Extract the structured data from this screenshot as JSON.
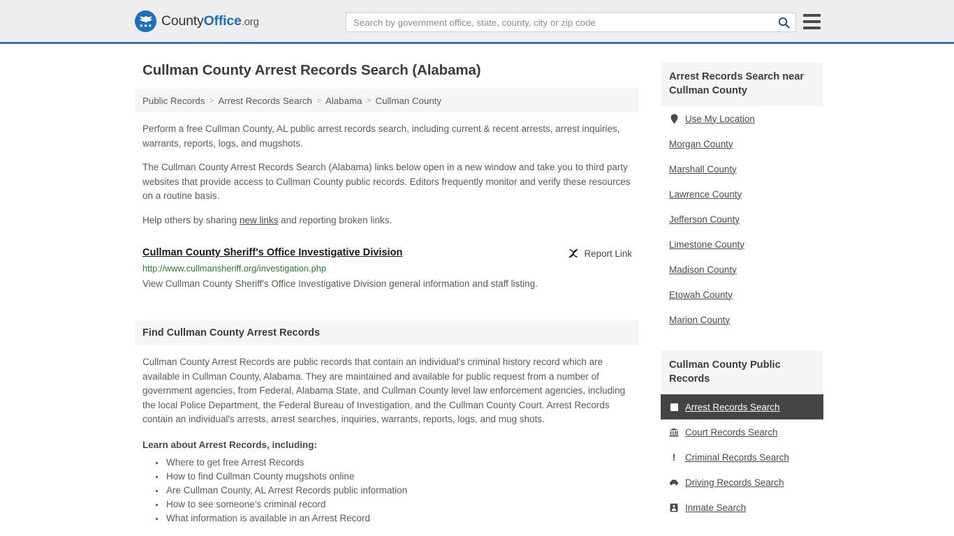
{
  "header": {
    "brand": {
      "part1": "County",
      "part2": "Office",
      "part3": ".org"
    },
    "search": {
      "placeholder": "Search by government office, state, county, city or zip code",
      "value": "",
      "icon": "search-icon"
    },
    "menu_icon": "hamburger-menu-icon"
  },
  "page": {
    "title": "Cullman County Arrest Records Search (Alabama)",
    "breadcrumb": [
      "Public Records",
      "Arrest Records Search",
      "Alabama",
      "Cullman County"
    ],
    "breadcrumb_separator": ">",
    "paragraph1": "Perform a free Cullman County, AL public arrest records search, including current & recent arrests, arrest inquiries, warrants, reports, logs, and mugshots.",
    "paragraph2": "The Cullman County Arrest Records Search (Alabama) links below open in a new window and take you to third party websites that provide access to Cullman County public records. Editors frequently monitor and verify these resources on a routine basis.",
    "paragraph3_before": "Help others by sharing ",
    "paragraph3_link": "new links",
    "paragraph3_after": " and reporting broken links."
  },
  "result": {
    "title": "Cullman County Sheriff's Office Investigative Division",
    "url": "http://www.cullmansheriff.org/investigation.php",
    "description": "View Cullman County Sheriff's Office Investigative Division general information and staff listing.",
    "report_label": "Report Link",
    "report_icon": "broken-link-icon"
  },
  "find_section": {
    "heading": "Find Cullman County Arrest Records",
    "body": "Cullman County Arrest Records are public records that contain an individual's criminal history record which are available in Cullman County, Alabama. They are maintained and available for public request from a number of government agencies, from Federal, Alabama State, and Cullman County level law enforcement agencies, including the local Police Department, the Federal Bureau of Investigation, and the Cullman County Court. Arrest Records contain an individual's arrests, arrest searches, inquiries, warrants, reports, logs, and mug shots.",
    "learn_heading": "Learn about Arrest Records, including:",
    "bullets": [
      "Where to get free Arrest Records",
      "How to find Cullman County mugshots online",
      "Are Cullman County, AL Arrest Records public information",
      "How to see someone's criminal record",
      "What information is available in an Arrest Record"
    ]
  },
  "sidebar": {
    "nearby": {
      "heading": "Arrest Records Search near Cullman County",
      "items": [
        {
          "label": "Use My Location",
          "icon": "map-pin-icon"
        },
        {
          "label": "Morgan County",
          "icon": ""
        },
        {
          "label": "Marshall County",
          "icon": ""
        },
        {
          "label": "Lawrence County",
          "icon": ""
        },
        {
          "label": "Jefferson County",
          "icon": ""
        },
        {
          "label": "Limestone County",
          "icon": ""
        },
        {
          "label": "Madison County",
          "icon": ""
        },
        {
          "label": "Etowah County",
          "icon": ""
        },
        {
          "label": "Marion County",
          "icon": ""
        }
      ]
    },
    "public_records": {
      "heading": "Cullman County Public Records",
      "items": [
        {
          "label": "Arrest Records Search",
          "icon": "square-icon",
          "active": true
        },
        {
          "label": "Court Records Search",
          "icon": "courthouse-icon",
          "active": false
        },
        {
          "label": "Criminal Records Search",
          "icon": "exclamation-icon",
          "active": false
        },
        {
          "label": "Driving Records Search",
          "icon": "car-icon",
          "active": false
        },
        {
          "label": "Inmate Search",
          "icon": "jail-icon",
          "active": false
        }
      ]
    }
  },
  "colors": {
    "accent_blue": "#3d76a8",
    "brand_blue": "#1d6fb8",
    "header_bg": "#eeeeee",
    "panel_bg": "#f5f5f5",
    "active_bg": "#444444",
    "url_green": "#2c7a2c"
  }
}
